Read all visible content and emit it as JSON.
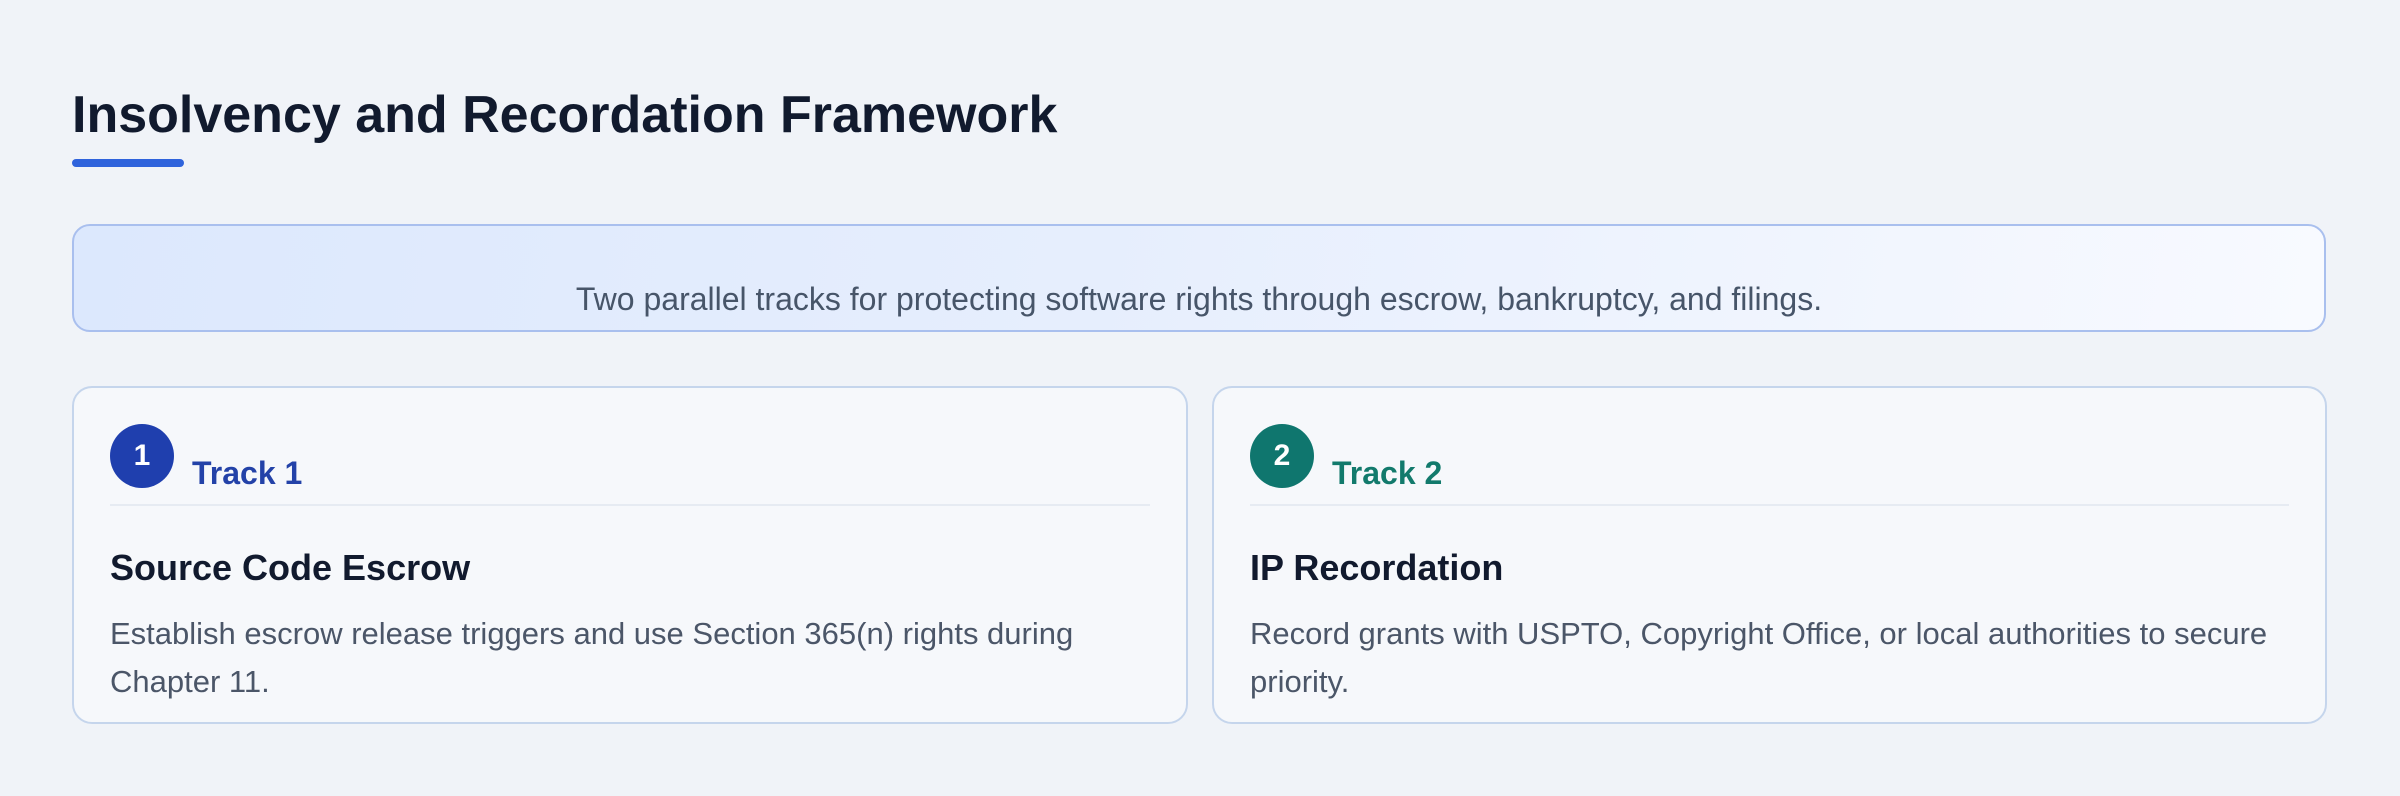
{
  "title": "Insolvency and Recordation Framework",
  "banner": {
    "text": "Two parallel tracks for protecting software rights through escrow, bankruptcy, and filings."
  },
  "tracks": [
    {
      "number": "1",
      "label": "Track 1",
      "title": "Source Code Escrow",
      "description": "Establish escrow release triggers and use Section 365(n) rights during Chapter 11.",
      "color": "#1f3fae"
    },
    {
      "number": "2",
      "label": "Track 2",
      "title": "IP Recordation",
      "description": "Record grants with USPTO, Copyright Office, or local authorities to secure priority.",
      "color": "#0f766e"
    }
  ],
  "colors": {
    "accent": "#2f63dc",
    "background": "#f0f3f8"
  }
}
